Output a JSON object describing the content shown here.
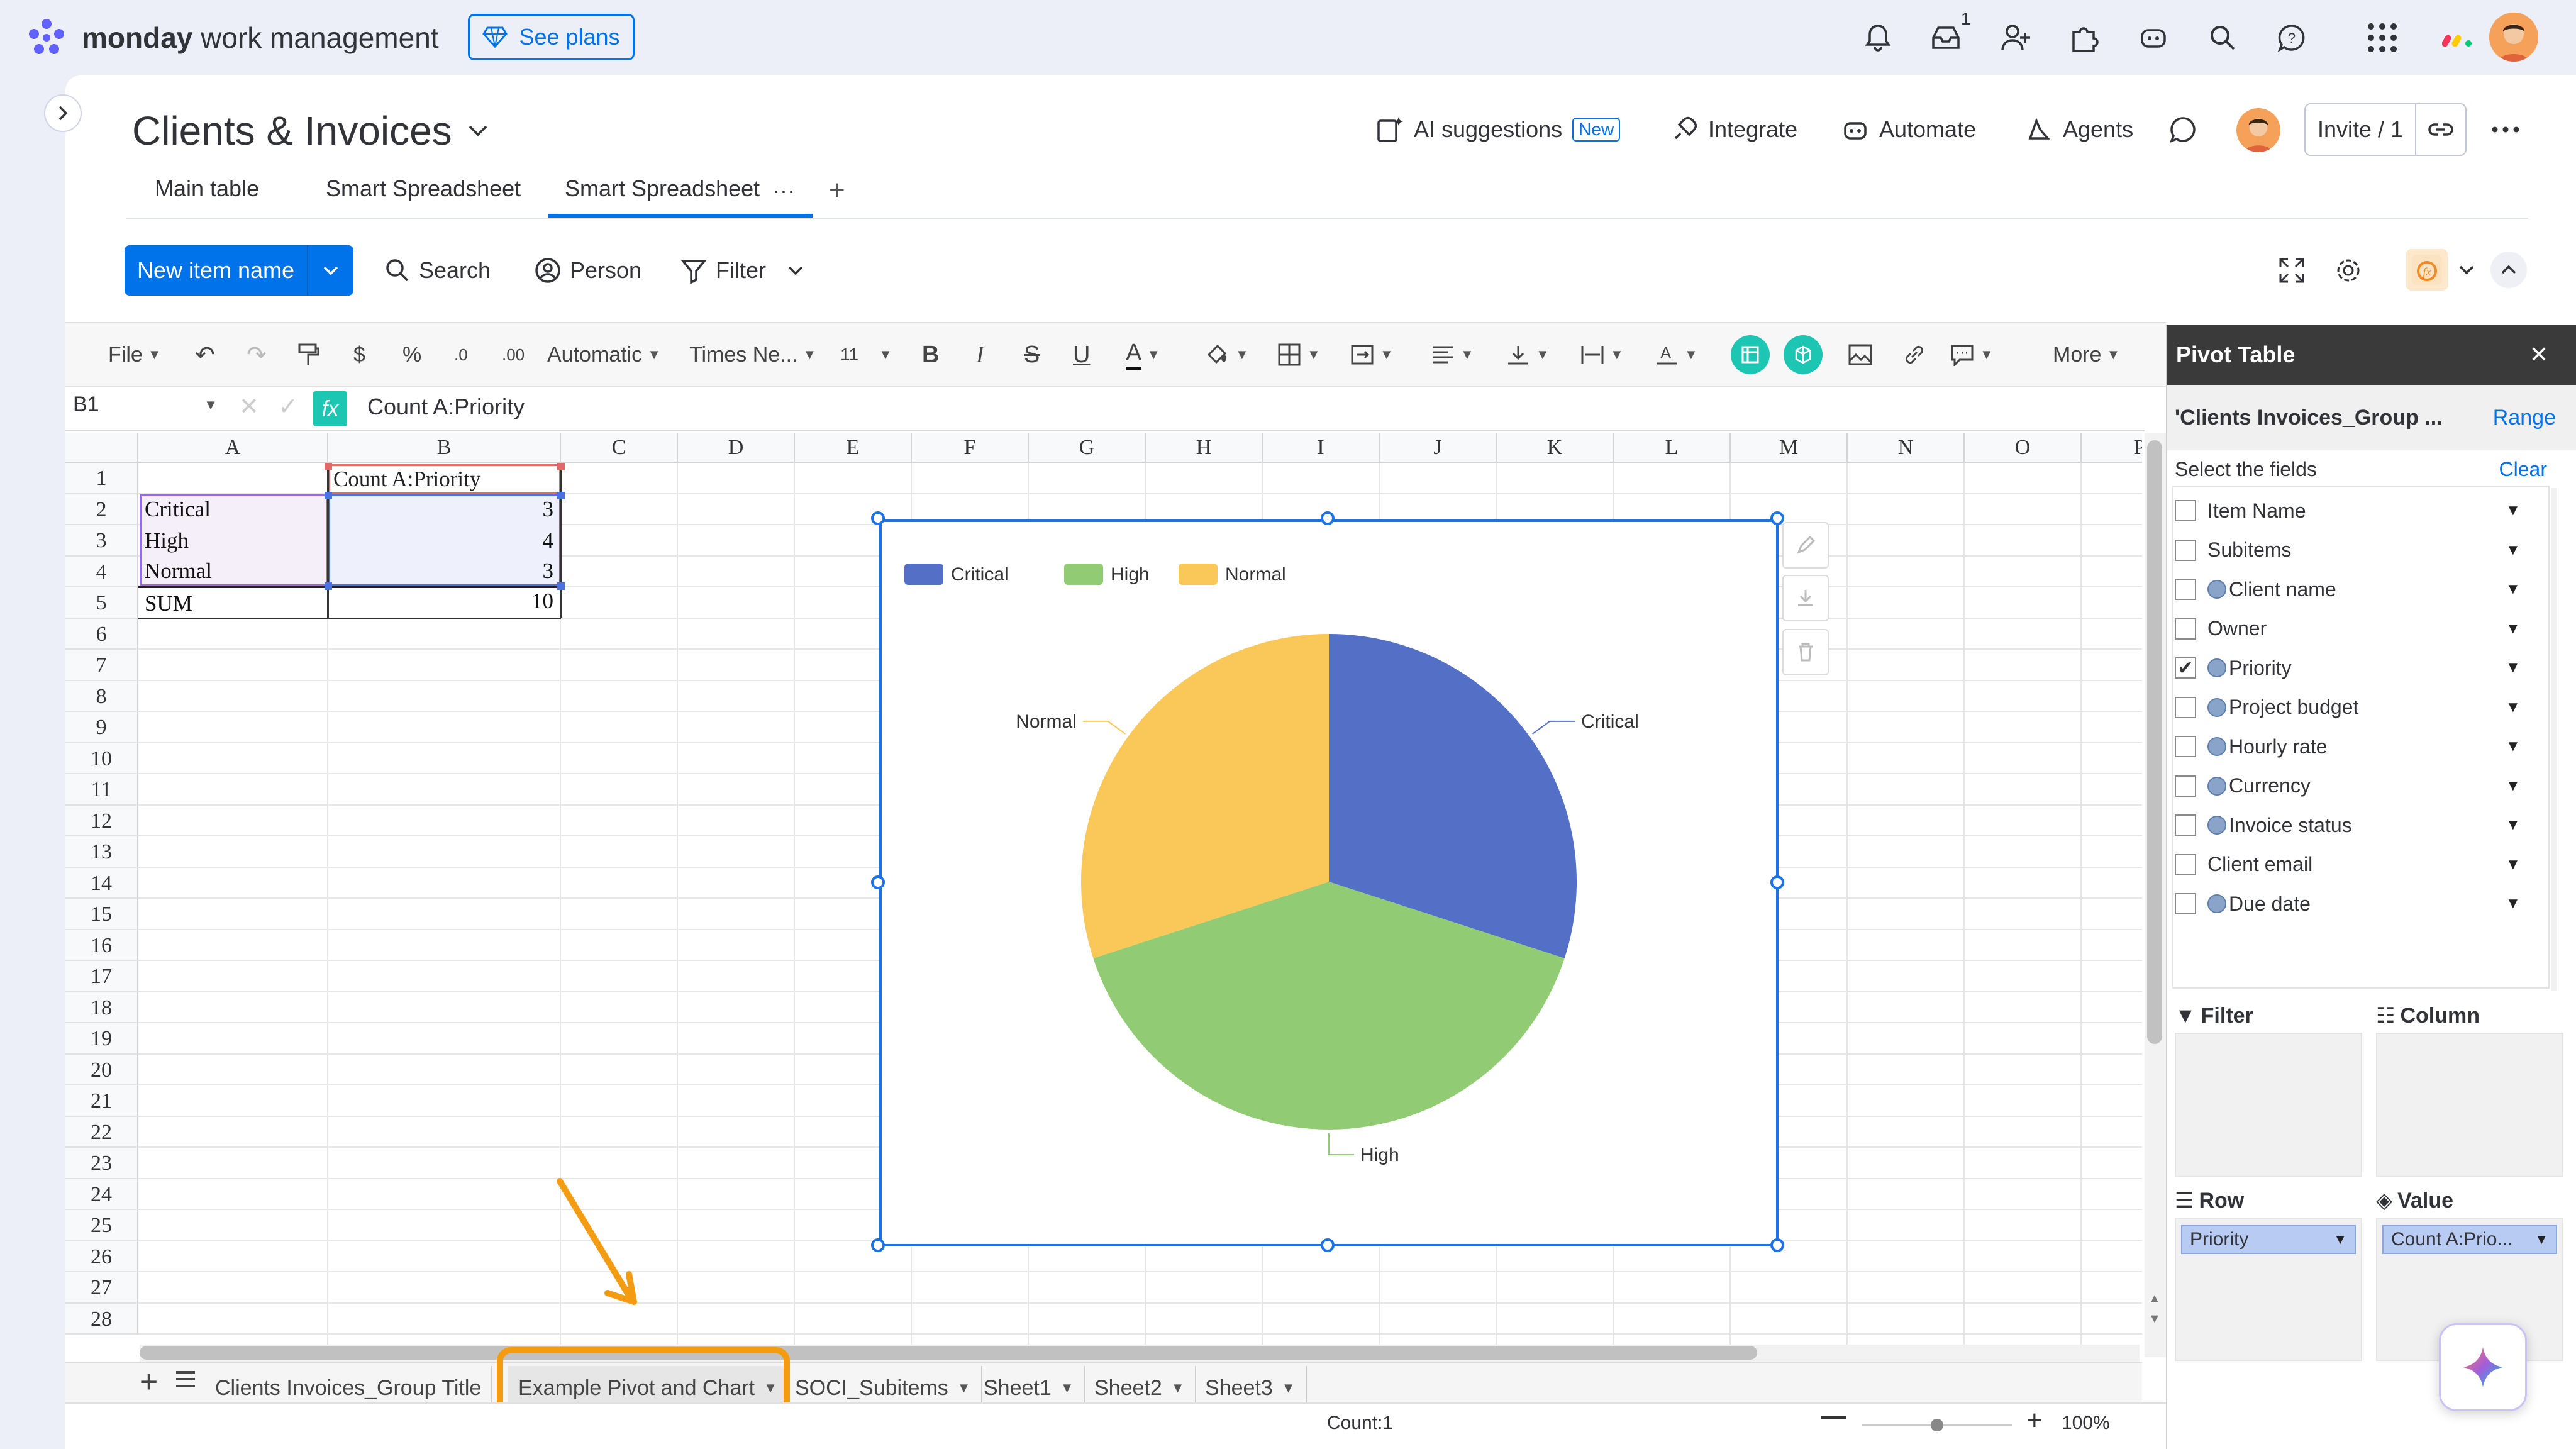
{
  "app": {
    "brand_bold": "monday",
    "brand_rest": " work management",
    "see_plans": "See plans",
    "notif_count": "1"
  },
  "board": {
    "title": "Clients & Invoices",
    "ai_suggestions": "AI suggestions",
    "new_badge": "New",
    "integrate": "Integrate",
    "automate": "Automate",
    "agents": "Agents",
    "invite": "Invite / 1"
  },
  "tabs": [
    {
      "label": "Main table"
    },
    {
      "label": "Smart Spreadsheet"
    },
    {
      "label": "Smart Spreadsheet"
    }
  ],
  "toolbar": {
    "new_item": "New item name",
    "search": "Search",
    "person": "Person",
    "filter": "Filter"
  },
  "ss_toolbar": {
    "file": "File",
    "dollar": "$",
    "percent": "%",
    "dec_dec": ".0",
    "dec_inc": ".00",
    "format": "Automatic",
    "font": "Times Ne...",
    "size": "11",
    "bold": "B",
    "italic": "I",
    "strike": "S",
    "underline": "U",
    "font_color": "A",
    "more": "More"
  },
  "formula": {
    "cell_ref": "B1",
    "fx": "fx",
    "content": "Count A:Priority"
  },
  "grid": {
    "columns": [
      "A",
      "B",
      "C",
      "D",
      "E",
      "F",
      "G",
      "H",
      "I",
      "J",
      "K",
      "L",
      "M",
      "N",
      "O",
      "P"
    ],
    "rows": [
      "1",
      "2",
      "3",
      "4",
      "5",
      "6",
      "7",
      "8",
      "9",
      "10",
      "11",
      "12",
      "13",
      "14",
      "15",
      "16",
      "17",
      "18",
      "19",
      "20",
      "21",
      "22",
      "23",
      "24",
      "25",
      "26",
      "27",
      "28"
    ],
    "b1": "Count A:Priority",
    "a2": "Critical",
    "b2": "3",
    "a3": "High",
    "b3": "4",
    "a4": "Normal",
    "b4": "3",
    "a5": "SUM",
    "b5": "10"
  },
  "chart_data": {
    "type": "pie",
    "categories": [
      "Critical",
      "High",
      "Normal"
    ],
    "values": [
      3,
      4,
      3
    ],
    "colors": [
      "#5470c6",
      "#91cc75",
      "#fac858"
    ],
    "legend": "top-left",
    "title": ""
  },
  "sheet_tabs": [
    {
      "label": "Clients Invoices_Group Title"
    },
    {
      "label": "Example Pivot and Chart"
    },
    {
      "label": "SOCI_Subitems"
    },
    {
      "label": "Sheet1"
    },
    {
      "label": "Sheet2"
    },
    {
      "label": "Sheet3"
    }
  ],
  "status": {
    "count": "Count:1",
    "zoom": "100%"
  },
  "pivot": {
    "title": "Pivot Table",
    "source": "'Clients Invoices_Group ...",
    "range": "Range",
    "select_fields": "Select the fields",
    "clear": "Clear",
    "fields": [
      {
        "label": "Item Name",
        "checked": false,
        "linked": false
      },
      {
        "label": "Subitems",
        "checked": false,
        "linked": false
      },
      {
        "label": "Client name",
        "checked": false,
        "linked": true
      },
      {
        "label": "Owner",
        "checked": false,
        "linked": false
      },
      {
        "label": "Priority",
        "checked": true,
        "linked": true
      },
      {
        "label": "Project budget",
        "checked": false,
        "linked": true
      },
      {
        "label": "Hourly rate",
        "checked": false,
        "linked": true
      },
      {
        "label": "Currency",
        "checked": false,
        "linked": true
      },
      {
        "label": "Invoice status",
        "checked": false,
        "linked": true
      },
      {
        "label": "Client email",
        "checked": false,
        "linked": false
      },
      {
        "label": "Due date",
        "checked": false,
        "linked": true
      }
    ],
    "filter": "Filter",
    "column": "Column",
    "row": "Row",
    "value": "Value",
    "row_pill": "Priority",
    "value_pill": "Count A:Prio..."
  }
}
